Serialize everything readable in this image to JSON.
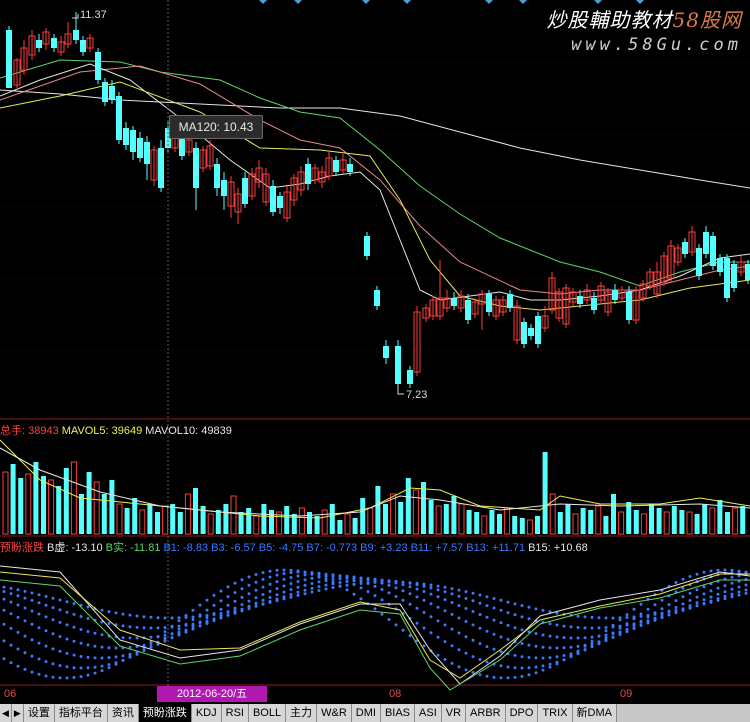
{
  "watermark": {
    "line1_a": "炒股輔助教材",
    "line1_b": "58股网",
    "line2": "www.58Gu.com"
  },
  "price_panel": {
    "high_label": "11.37",
    "low_label": "7.23",
    "tooltip": "MA120: 10.43",
    "colors": {
      "up": "#ff3b3b",
      "down": "#54ffff",
      "ma_white": "#e6e6e6",
      "ma_yellow": "#e8e85a",
      "ma_green": "#5fd66a",
      "ma_pink": "#e68a8a"
    }
  },
  "volume_panel": {
    "legend": [
      {
        "text": "总手: 38943",
        "color": "#ff4040"
      },
      {
        "text": "MAVOL5: 39649",
        "color": "#f0f050"
      },
      {
        "text": "MAVOL10: 49839",
        "color": "#e6e6e6"
      }
    ]
  },
  "indicator_panel": {
    "legend": [
      {
        "text": "预盼涨跌",
        "color": "#ff4040"
      },
      {
        "text": "B虚: -13.10",
        "color": "#e6e6e6"
      },
      {
        "text": "B实: -11.81",
        "color": "#5fd66a"
      },
      {
        "text": "B1: -8.83",
        "color": "#3a78ff"
      },
      {
        "text": "B3: -6.57",
        "color": "#3a78ff"
      },
      {
        "text": "B5: -4.75",
        "color": "#3a78ff"
      },
      {
        "text": "B7: -0.773",
        "color": "#3a78ff"
      },
      {
        "text": "B9: +3.23",
        "color": "#3a78ff"
      },
      {
        "text": "B11: +7.57",
        "color": "#3a78ff"
      },
      {
        "text": "B13: +11.71",
        "color": "#3a78ff"
      },
      {
        "text": "B15: +10.68",
        "color": "#e6e6e6"
      }
    ]
  },
  "x_axis": {
    "labels": [
      "06",
      "08",
      "09"
    ],
    "cursor_date": "2012-06-20/五"
  },
  "tabs": [
    "设置",
    "指标平台",
    "资讯",
    "预盼涨跌",
    "KDJ",
    "RSI",
    "BOLL",
    "主力",
    "W&R",
    "DMI",
    "BIAS",
    "ASI",
    "VR",
    "ARBR",
    "DPO",
    "TRIX",
    "新DMA"
  ],
  "active_tab": "预盼涨跌"
}
